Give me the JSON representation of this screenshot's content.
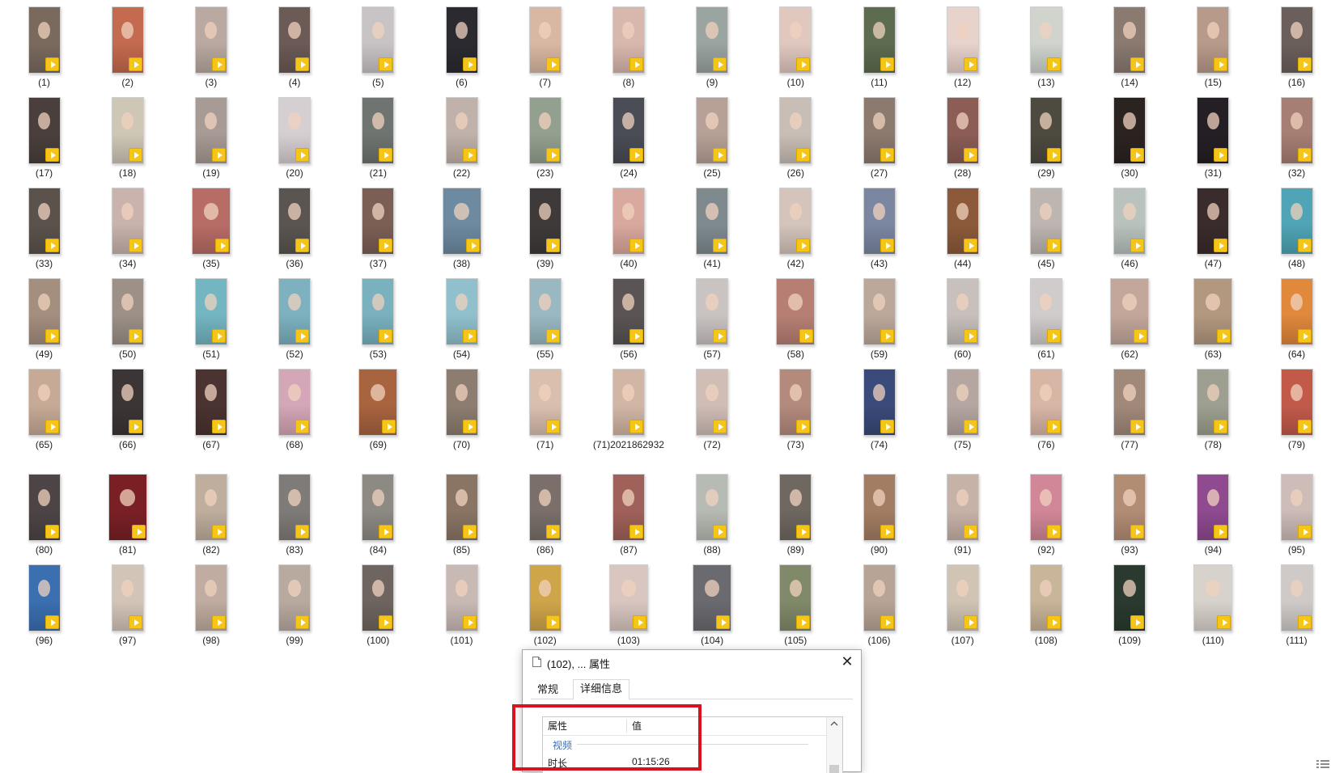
{
  "files": [
    {
      "label": "(1)",
      "color": "#7a6a5e"
    },
    {
      "label": "(2)",
      "color": "#c46a4e"
    },
    {
      "label": "(3)",
      "color": "#b9a9a0"
    },
    {
      "label": "(4)",
      "color": "#6b5a55"
    },
    {
      "label": "(5)",
      "color": "#c8c3c5"
    },
    {
      "label": "(6)",
      "color": "#2a2a30"
    },
    {
      "label": "(7)",
      "color": "#d9b8a3"
    },
    {
      "label": "(8)",
      "color": "#d8b8ad"
    },
    {
      "label": "(9)",
      "color": "#9aa4a0"
    },
    {
      "label": "(10)",
      "color": "#e0c8bf"
    },
    {
      "label": "(11)",
      "color": "#5d6b4f"
    },
    {
      "label": "(12)",
      "color": "#e8d2cc"
    },
    {
      "label": "(13)",
      "color": "#d0d4cd"
    },
    {
      "label": "(14)",
      "color": "#8a7a70"
    },
    {
      "label": "(15)",
      "color": "#b89a8a"
    },
    {
      "label": "(16)",
      "color": "#6b5f5b"
    },
    {
      "label": "(17)",
      "color": "#4a3f3c"
    },
    {
      "label": "(18)",
      "color": "#cfc7b6"
    },
    {
      "label": "(19)",
      "color": "#a89a94"
    },
    {
      "label": "(20)",
      "color": "#d6cfd2"
    },
    {
      "label": "(21)",
      "color": "#6f7470"
    },
    {
      "label": "(22)",
      "color": "#c0b2aa"
    },
    {
      "label": "(23)",
      "color": "#93a08f"
    },
    {
      "label": "(24)",
      "color": "#4a4d55"
    },
    {
      "label": "(25)",
      "color": "#b7a196"
    },
    {
      "label": "(26)",
      "color": "#c9beb6"
    },
    {
      "label": "(27)",
      "color": "#8c7a6e"
    },
    {
      "label": "(28)",
      "color": "#8b5d55"
    },
    {
      "label": "(29)",
      "color": "#4d4a40"
    },
    {
      "label": "(30)",
      "color": "#2b2320"
    },
    {
      "label": "(31)",
      "color": "#241f24"
    },
    {
      "label": "(32)",
      "color": "#a67e73"
    },
    {
      "label": "(33)",
      "color": "#5b524c"
    },
    {
      "label": "(34)",
      "color": "#c9b3ac"
    },
    {
      "label": "(35)",
      "color": "#b86c66"
    },
    {
      "label": "(36)",
      "color": "#5a5550"
    },
    {
      "label": "(37)",
      "color": "#7b5f55"
    },
    {
      "label": "(38)",
      "color": "#6e8aa0"
    },
    {
      "label": "(39)",
      "color": "#3f3a3a"
    },
    {
      "label": "(40)",
      "color": "#d9a89e"
    },
    {
      "label": "(41)",
      "color": "#7f8a8f"
    },
    {
      "label": "(42)",
      "color": "#d4c4bb"
    },
    {
      "label": "(43)",
      "color": "#7b86a0"
    },
    {
      "label": "(44)",
      "color": "#8c5a3a"
    },
    {
      "label": "(45)",
      "color": "#bdb5b0"
    },
    {
      "label": "(46)",
      "color": "#b9c2bd"
    },
    {
      "label": "(47)",
      "color": "#3a2b2c"
    },
    {
      "label": "(48)",
      "color": "#4fa4b5"
    },
    {
      "label": "(49)",
      "color": "#a48e7e"
    },
    {
      "label": "(50)",
      "color": "#9c9087"
    },
    {
      "label": "(51)",
      "color": "#74b5c2"
    },
    {
      "label": "(52)",
      "color": "#7db1c0"
    },
    {
      "label": "(53)",
      "color": "#79b1bf"
    },
    {
      "label": "(54)",
      "color": "#8fc0cc"
    },
    {
      "label": "(55)",
      "color": "#9ab8c2"
    },
    {
      "label": "(56)",
      "color": "#5a5454"
    },
    {
      "label": "(57)",
      "color": "#c9c3c2"
    },
    {
      "label": "(58)",
      "color": "#b77f74"
    },
    {
      "label": "(59)",
      "color": "#bca89b"
    },
    {
      "label": "(60)",
      "color": "#c7c0bc"
    },
    {
      "label": "(61)",
      "color": "#d1cccc"
    },
    {
      "label": "(62)",
      "color": "#c2a79a"
    },
    {
      "label": "(63)",
      "color": "#b2987f"
    },
    {
      "label": "(64)",
      "color": "#e0883c"
    },
    {
      "label": "(65)",
      "color": "#c6aa96"
    },
    {
      "label": "(66)",
      "color": "#3c3535"
    },
    {
      "label": "(67)",
      "color": "#4a3330"
    },
    {
      "label": "(68)",
      "color": "#d4a6b7"
    },
    {
      "label": "(69)",
      "color": "#a8633f"
    },
    {
      "label": "(70)",
      "color": "#8c7d70"
    },
    {
      "label": "(71)",
      "color": "#d9bfae"
    },
    {
      "label": "(71)2021862932",
      "color": "#d2b6a5"
    },
    {
      "label": "(72)",
      "color": "#cfbdb6"
    },
    {
      "label": "(73)",
      "color": "#b48a7d"
    },
    {
      "label": "(74)",
      "color": "#3a4a7a"
    },
    {
      "label": "(75)",
      "color": "#b5a6a1"
    },
    {
      "label": "(76)",
      "color": "#d8b6a6"
    },
    {
      "label": "(77)",
      "color": "#a1897a"
    },
    {
      "label": "(78)",
      "color": "#9d9f90"
    },
    {
      "label": "(79)",
      "color": "#c25a4a"
    },
    {
      "label": "(80)",
      "color": "#4d4545"
    },
    {
      "label": "(81)",
      "color": "#7a2025"
    },
    {
      "label": "(82)",
      "color": "#bfae9e"
    },
    {
      "label": "(83)",
      "color": "#7f7b78"
    },
    {
      "label": "(84)",
      "color": "#8d8983"
    },
    {
      "label": "(85)",
      "color": "#8a7565"
    },
    {
      "label": "(86)",
      "color": "#7a6f6a"
    },
    {
      "label": "(87)",
      "color": "#a0615a"
    },
    {
      "label": "(88)",
      "color": "#b6bbb3"
    },
    {
      "label": "(89)",
      "color": "#6f6860"
    },
    {
      "label": "(90)",
      "color": "#a37d63"
    },
    {
      "label": "(91)",
      "color": "#c7b2a7"
    },
    {
      "label": "(92)",
      "color": "#d18797"
    },
    {
      "label": "(93)",
      "color": "#b38c74"
    },
    {
      "label": "(94)",
      "color": "#8f4a90"
    },
    {
      "label": "(95)",
      "color": "#cdbcb8"
    },
    {
      "label": "(96)",
      "color": "#3b6fb0"
    },
    {
      "label": "(97)",
      "color": "#d3c4b8"
    },
    {
      "label": "(98)",
      "color": "#c0aca0"
    },
    {
      "label": "(99)",
      "color": "#b9aaa0"
    },
    {
      "label": "(100)",
      "color": "#6e6560"
    },
    {
      "label": "(101)",
      "color": "#c9b9b5"
    },
    {
      "label": "(102)",
      "color": "#cfa54a"
    },
    {
      "label": "(103)",
      "color": "#d9c6c0"
    },
    {
      "label": "(104)",
      "color": "#6a6a70"
    },
    {
      "label": "(105)",
      "color": "#808a6a"
    },
    {
      "label": "(106)",
      "color": "#b8a496"
    },
    {
      "label": "(107)",
      "color": "#d0c4b4"
    },
    {
      "label": "(108)",
      "color": "#c8b59a"
    },
    {
      "label": "(109)",
      "color": "#2a3a2e"
    },
    {
      "label": "(110)",
      "color": "#d8d2cc"
    },
    {
      "label": "(111)",
      "color": "#cfcac8"
    }
  ],
  "badge_color": "#f5c518",
  "dialog": {
    "title": "(102), ... 属性",
    "close_glyph": "✕",
    "tabs": [
      "常规",
      "详细信息"
    ],
    "active_tab": "详细信息",
    "columns": {
      "property": "属性",
      "value": "值"
    },
    "group": "视频",
    "rows": [
      {
        "name": "时长",
        "value": "01:15:26"
      }
    ]
  },
  "highlight_color": "#d8121e"
}
